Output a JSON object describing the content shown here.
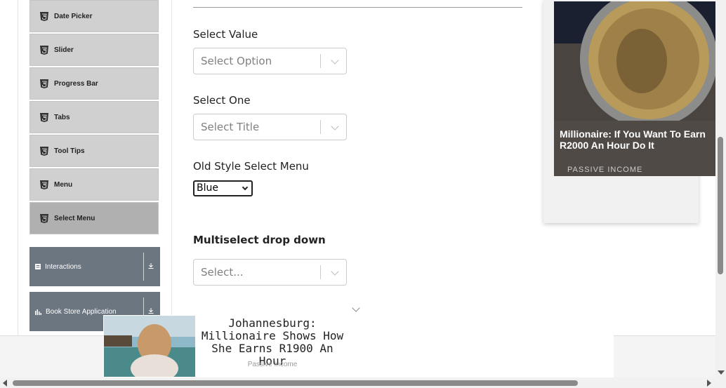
{
  "sidebar": {
    "items": [
      {
        "label": "Date Picker",
        "icon": "html5-icon"
      },
      {
        "label": "Slider",
        "icon": "html5-icon"
      },
      {
        "label": "Progress Bar",
        "icon": "html5-icon"
      },
      {
        "label": "Tabs",
        "icon": "html5-icon"
      },
      {
        "label": "Tool Tips",
        "icon": "html5-icon"
      },
      {
        "label": "Menu",
        "icon": "html5-icon"
      },
      {
        "label": "Select Menu",
        "icon": "html5-icon",
        "active": true
      }
    ],
    "groups": [
      {
        "label": "Interactions",
        "icon": "list-icon"
      },
      {
        "label": "Book Store Application",
        "icon": "chart-icon"
      }
    ]
  },
  "main": {
    "select_value": {
      "label": "Select Value",
      "placeholder": "Select Option"
    },
    "select_one": {
      "label": "Select One",
      "placeholder": "Select Title"
    },
    "old_style": {
      "label": "Old Style Select Menu",
      "value": "Blue"
    },
    "multiselect": {
      "label": "Multiselect drop down",
      "placeholder": "Select..."
    }
  },
  "ad_right": {
    "title": "Millionaire: If You Want To Earn R2000 An Hour Do It",
    "source": "PASSIVE INCOME"
  },
  "ad_bottom": {
    "title": "Johannesburg: Millionaire Shows How She Earns R1900 An Hour",
    "source": "Passive Income"
  },
  "colors": {
    "group_bg": "#6b7681",
    "item_bg": "#d0d0d0",
    "item_active_bg": "#b0b0b0"
  }
}
